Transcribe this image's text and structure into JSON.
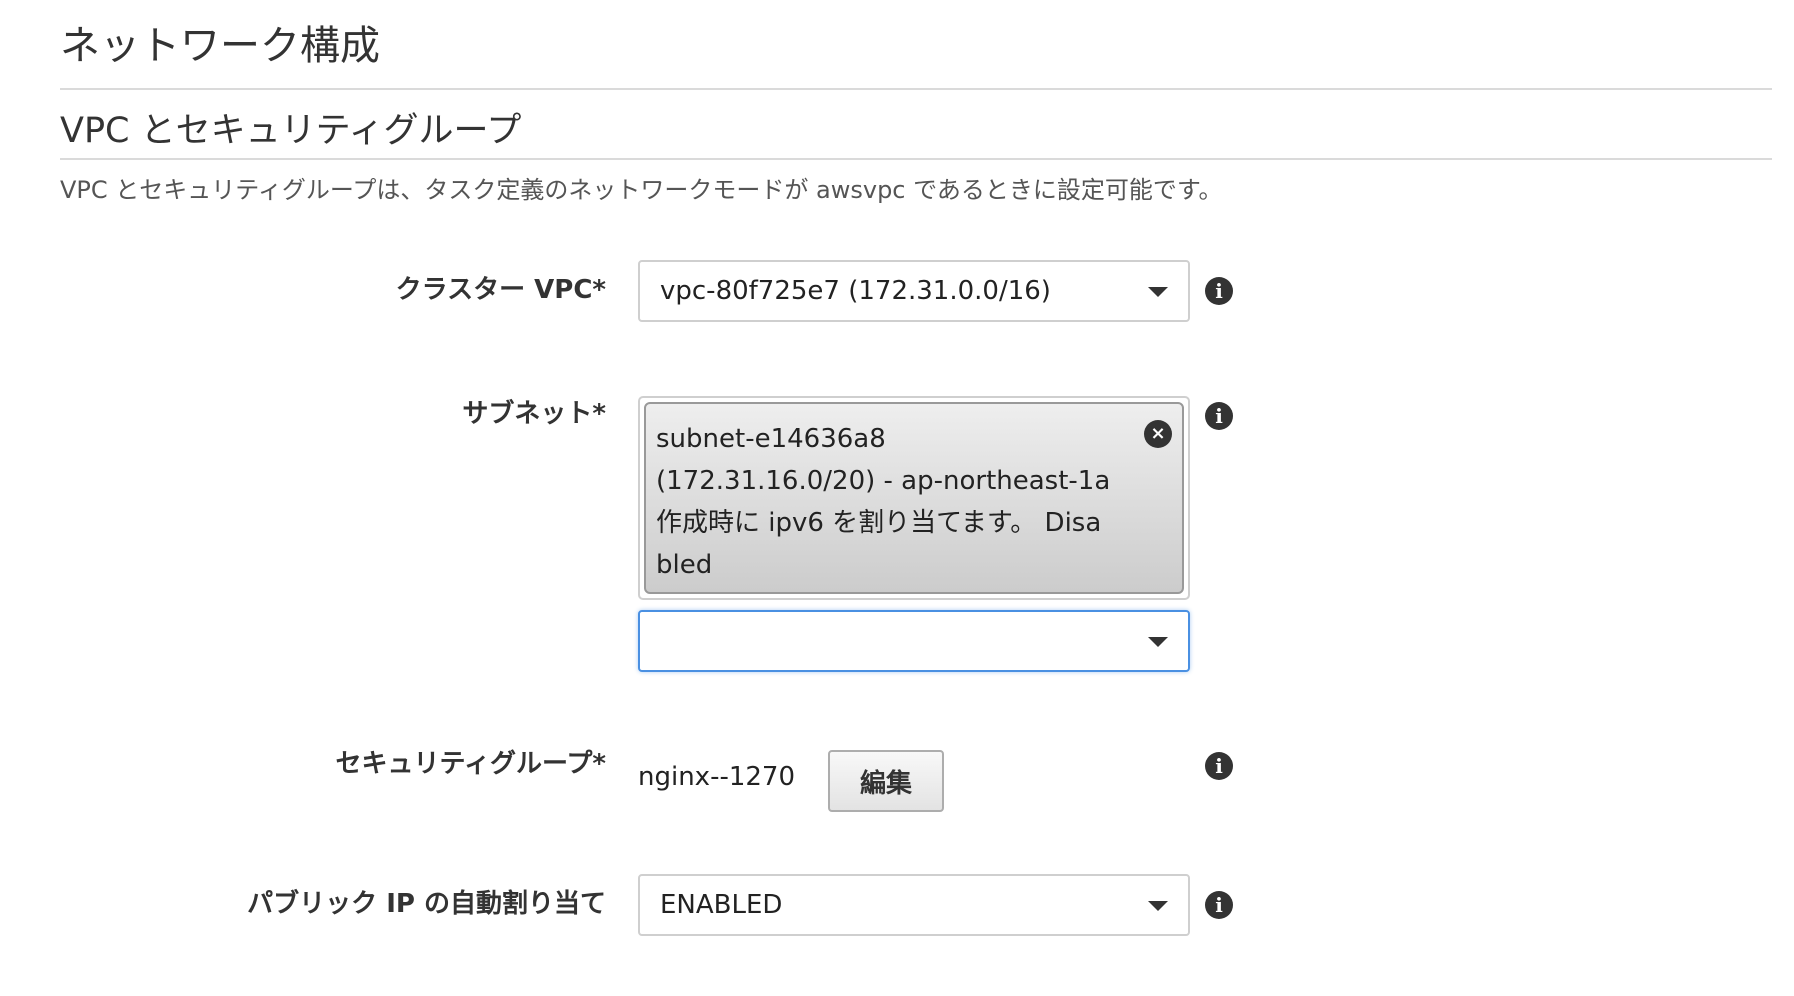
{
  "section": {
    "title": "ネットワーク構成"
  },
  "subsection": {
    "title": "VPC とセキュリティグループ",
    "description": "VPC とセキュリティグループは、タスク定義のネットワークモードが awsvpc であるときに設定可能です。"
  },
  "fields": {
    "cluster_vpc": {
      "label": "クラスター VPC*",
      "value": "vpc-80f725e7 (172.31.0.0/16)"
    },
    "subnet": {
      "label": "サブネット*",
      "selected_chip": {
        "line1": "subnet-e14636a8",
        "line2": "(172.31.16.0/20) - ap-northeast-1a",
        "line3": "作成時に ipv6 を割り当てます。 Disa",
        "line4": "bled"
      },
      "search_value": ""
    },
    "security_group": {
      "label": "セキュリティグループ*",
      "value": "nginx--1270",
      "edit_label": "編集"
    },
    "public_ip": {
      "label": "パブリック IP の自動割り当て",
      "value": "ENABLED"
    }
  },
  "icons": {
    "info": "i",
    "remove": "×"
  }
}
